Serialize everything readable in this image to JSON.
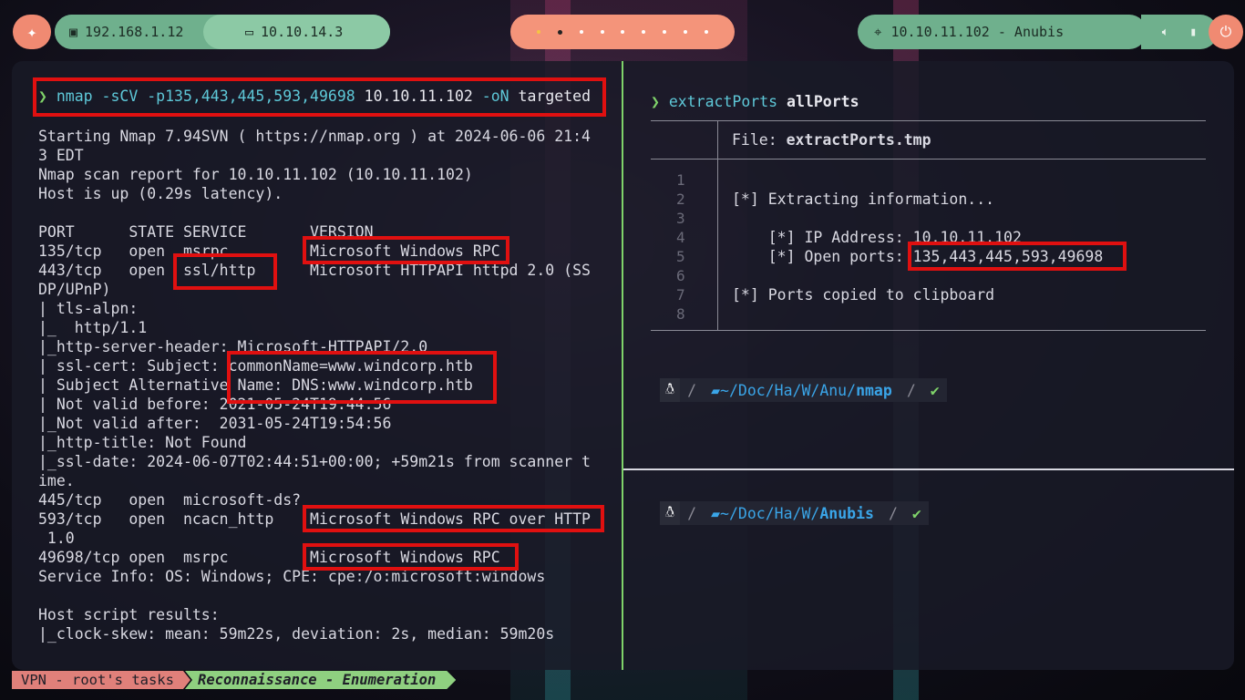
{
  "topbar": {
    "local_ip": "192.168.1.12",
    "vpn_ip": "10.10.14.3",
    "target": "10.10.11.102 - Anubis",
    "workspaces": 9,
    "active_workspace": 2
  },
  "left_pane": {
    "command": {
      "prompt": "❯",
      "name": "nmap",
      "args": " -sCV -p135,443,445,593,49698 ",
      "host": "10.10.11.102",
      "flag": " -oN ",
      "file": "targeted"
    },
    "output": [
      "Starting Nmap 7.94SVN ( https://nmap.org ) at 2024-06-06 21:4",
      "3 EDT",
      "Nmap scan report for 10.10.11.102 (10.10.11.102)",
      "Host is up (0.29s latency).",
      "",
      "PORT      STATE SERVICE       VERSION",
      "135/tcp   open  msrpc         Microsoft Windows RPC",
      "443/tcp   open  ssl/http      Microsoft HTTPAPI httpd 2.0 (SS",
      "DP/UPnP)",
      "| tls-alpn:",
      "|_  http/1.1",
      "|_http-server-header: Microsoft-HTTPAPI/2.0",
      "| ssl-cert: Subject: commonName=www.windcorp.htb",
      "| Subject Alternative Name: DNS:www.windcorp.htb",
      "| Not valid before: 2021-05-24T19:44:56",
      "|_Not valid after:  2031-05-24T19:54:56",
      "|_http-title: Not Found",
      "|_ssl-date: 2024-06-07T02:44:51+00:00; +59m21s from scanner t",
      "ime.",
      "445/tcp   open  microsoft-ds?",
      "593/tcp   open  ncacn_http    Microsoft Windows RPC over HTTP",
      " 1.0",
      "49698/tcp open  msrpc         Microsoft Windows RPC",
      "Service Info: OS: Windows; CPE: cpe:/o:microsoft:windows",
      "",
      "Host script results:",
      "|_clock-skew: mean: 59m22s, deviation: 2s, median: 59m20s"
    ]
  },
  "right_top": {
    "prompt": "❯",
    "command": "extractPorts",
    "arg": "allPorts",
    "file_label": "File: ",
    "file_name": "extractPorts.tmp",
    "line_numbers": "1\n2\n3\n4\n5\n6\n7\n8",
    "lines": [
      "",
      "[*] Extracting information...",
      "",
      "    [*] IP Address: 10.10.11.102",
      "    [*] Open ports: 135,443,445,593,49698",
      "",
      "[*] Ports copied to clipboard",
      ""
    ],
    "prompt_path": "~/Doc/Ha/W/Anu/",
    "prompt_dir": "nmap",
    "check": "✔"
  },
  "right_bottom": {
    "prompt_path": "~/Doc/Ha/W/",
    "prompt_dir": "Anubis",
    "check": "✔"
  },
  "statusbar": {
    "session": "VPN - root's tasks",
    "window": "Reconnaissance - Enumeration"
  }
}
